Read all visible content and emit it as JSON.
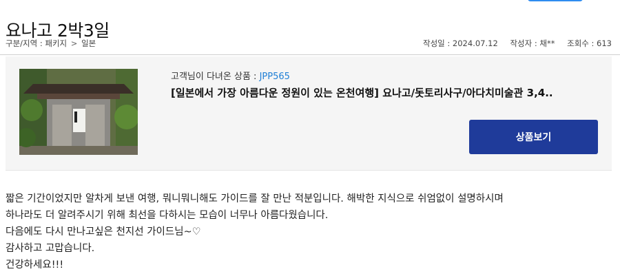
{
  "page": {
    "title": "요나고 2박3일"
  },
  "breadcrumb": {
    "prefix": "구분/지역 : 패키지",
    "chevron": ">",
    "last": "일본"
  },
  "meta": {
    "date": "작성일 : 2024.07.12",
    "author": "작성자 : 채**",
    "views": "조회수 : 613"
  },
  "product": {
    "label": "고객님이 다녀온 상품 : ",
    "code": "JPP565",
    "name": "[일본에서 가장 아름다운 정원이 있는 온천여행] 요나고/돗토리사구/아다치미술관 3,4..",
    "button": "상품보기"
  },
  "review": {
    "lines": [
      "짧은 기간이었지만 알차게 보낸 여행, 뭐니뭐니해도 가이드를 잘 만난 적분입니다. 해박한 지식으로 쉬엄없이 설명하시며",
      "하나라도 더 알려주시기 위해 최선을 다하시는 모습이 너무나 아름다웠습니다.",
      "다음에도 다시 만나고싶은 천지선 가이드님~♡",
      "감사하고 고맙습니다.",
      "건강하세요!!!"
    ]
  },
  "icons": {
    "thumbnail": "inn-entrance-photo"
  },
  "colors": {
    "accent_blue": "#1f7fd6",
    "button_bg": "#1f3b9a",
    "box_bg": "#f5f5f5"
  }
}
